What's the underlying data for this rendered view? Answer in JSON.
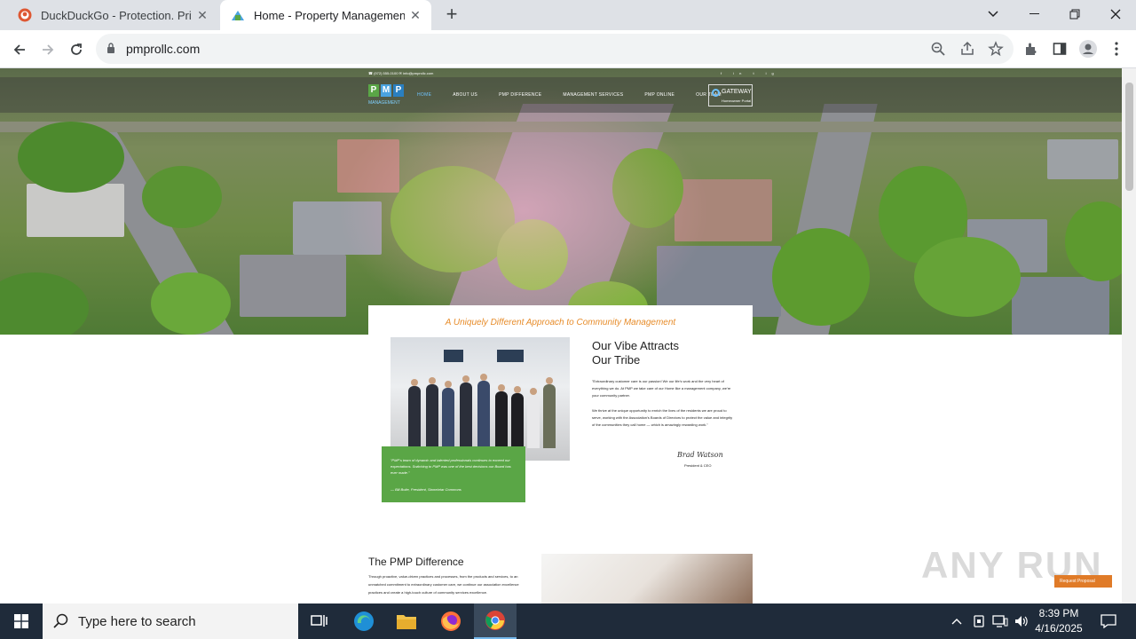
{
  "browser": {
    "tabs": [
      {
        "title": "DuckDuckGo - Protection. Privacy",
        "active": false
      },
      {
        "title": "Home - Property Management Inc",
        "active": true
      }
    ],
    "new_tab": "+",
    "url": "pmprollc.com"
  },
  "site": {
    "contact": "☎ (972) 555-0100   ✉ info@pmprollc.com",
    "social": "f in t ig",
    "logo_letters": [
      "P",
      "M",
      "P"
    ],
    "logo_sub": "MANAGEMENT",
    "nav": [
      "HOME",
      "ABOUT US",
      "PMP DIFFERENCE",
      "MANAGEMENT SERVICES",
      "PMP ONLINE",
      "OUR TEAM"
    ],
    "gateway_title": "GATEWAY",
    "gateway_sub": "Homeowner Portal",
    "tagline": "A Uniquely Different Approach to Community Management",
    "vibe_line1": "Our Vibe Attracts",
    "vibe_line2": "Our Tribe",
    "para1": "\"Extraordinary customer care is our passion! We our life's work and the very heart of everything we do. At PMP we take care of our Home like a management company, we're your community partner.",
    "para2": "We thrive at the unique opportunity to enrich the lives of the residents we are proud to serve, working with the Association's Boards of Directors to protect the value and integrity of the communities they call home — which is amazingly rewarding work.\"",
    "signature": "Brad Watson",
    "signature_role": "President & CEO",
    "quote": "\"PMP's team of dynamic and talented professionals continues to exceed our expectations. Switching to PMP was one of the best decisions our Board has ever made.\"",
    "quote_author": "— Bill Bolte, President, Stonebriar Commons",
    "diff_title": "The PMP Difference",
    "diff_text": "Through proactive, value-driven practices and processes, from the products and services, to an unmatched commitment to extraordinary customer care, we continue our association excellence practices and create a high-touch culture of community services excellence.",
    "request_button": "Request Proposal",
    "watermark": "ANY RUN"
  },
  "taskbar": {
    "search_placeholder": "Type here to search",
    "time": "8:39 PM",
    "date": "4/16/2025"
  }
}
